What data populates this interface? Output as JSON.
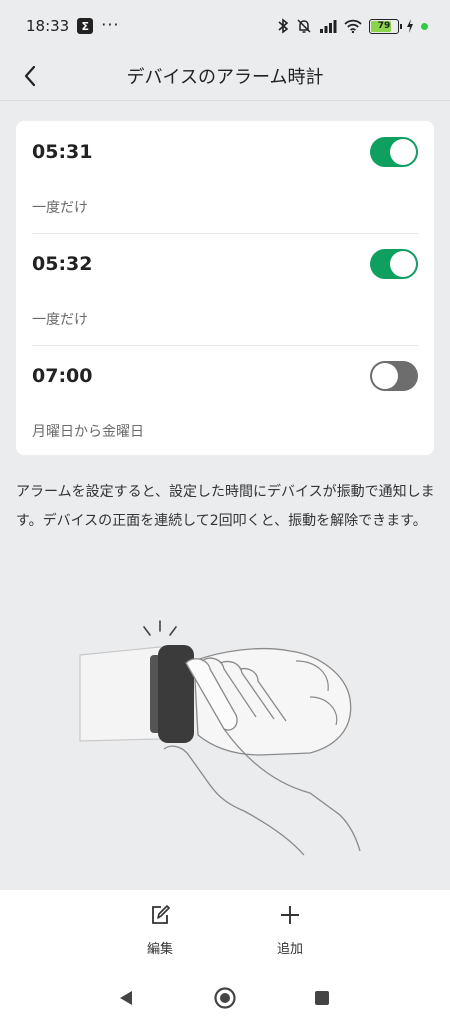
{
  "status_bar": {
    "time": "18:33",
    "app_icon": "Σ",
    "more_dots": "···",
    "battery_level": "79",
    "battery_percent": 79,
    "icons": [
      "bluetooth-icon",
      "bell-off-icon",
      "signal-icon",
      "wifi-icon",
      "battery-icon",
      "charging-icon",
      "green-dot"
    ]
  },
  "header": {
    "title": "デバイスのアラーム時計",
    "back_icon": "chevron-left-icon"
  },
  "alarms": [
    {
      "time": "05:31",
      "repeat": "一度だけ",
      "enabled": true
    },
    {
      "time": "05:32",
      "repeat": "一度だけ",
      "enabled": true
    },
    {
      "time": "07:00",
      "repeat": "月曜日から金曜日",
      "enabled": false
    }
  ],
  "description": "アラームを設定すると、設定した時間にデバイスが振動で通知します。デバイスの正面を連続して2回叩くと、振動を解除できます。",
  "toolbar": {
    "edit_label": "編集",
    "add_label": "追加",
    "edit_icon": "edit-icon",
    "add_icon": "plus-icon"
  },
  "nav": {
    "back_icon": "triangle-back-icon",
    "home_icon": "circle-home-icon",
    "recent_icon": "square-recent-icon"
  },
  "colors": {
    "toggle_on": "#0f9f5e",
    "toggle_off": "#6d6d6d",
    "background": "#ebecee",
    "battery_fill": "#8bd34a"
  }
}
